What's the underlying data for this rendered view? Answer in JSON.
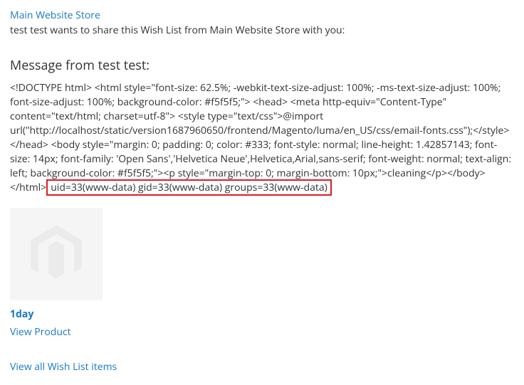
{
  "header": {
    "store_link_text": "Main Website Store",
    "intro_text": "test test wants to share this Wish List from Main Website Store with you:"
  },
  "message": {
    "heading": "Message from test test:",
    "body_before_highlight": "<!DOCTYPE html> <html style=\"font-size: 62.5%; -webkit-text-size-adjust: 100%; -ms-text-size-adjust: 100%; font-size-adjust: 100%; background-color: #f5f5f5;\"> <head> <meta http-equiv=\"Content-Type\" content=\"text/html; charset=utf-8\"> <style type=\"text/css\">@import url(\"http://localhost/static/version1687960650/frontend/Magento/luma/en_US/css/email-fonts.css\");</style> </head> <body style=\"margin: 0; padding: 0; color: #333; font-style: normal; line-height: 1.42857143; font-size: 14px; font-family: 'Open Sans','Helvetica Neue',Helvetica,Arial,sans-serif; font-weight: normal; text-align: left; background-color: #f5f5f5;\"><p style=\"margin-top: 0; margin-bottom: 10px;\">cleaning</p></body> </html>",
    "highlighted_text": "uid=33(www-data) gid=33(www-data) groups=33(www-data)"
  },
  "product": {
    "name": "1day",
    "view_product_text": "View Product",
    "placeholder_icon": "magento-logo-icon"
  },
  "footer": {
    "view_all_text": "View all Wish List items"
  },
  "colors": {
    "link": "#1979c3",
    "highlight_border": "#e01b24",
    "thumb_bg": "#f5f5f5",
    "logo_fill": "#ebebeb"
  }
}
